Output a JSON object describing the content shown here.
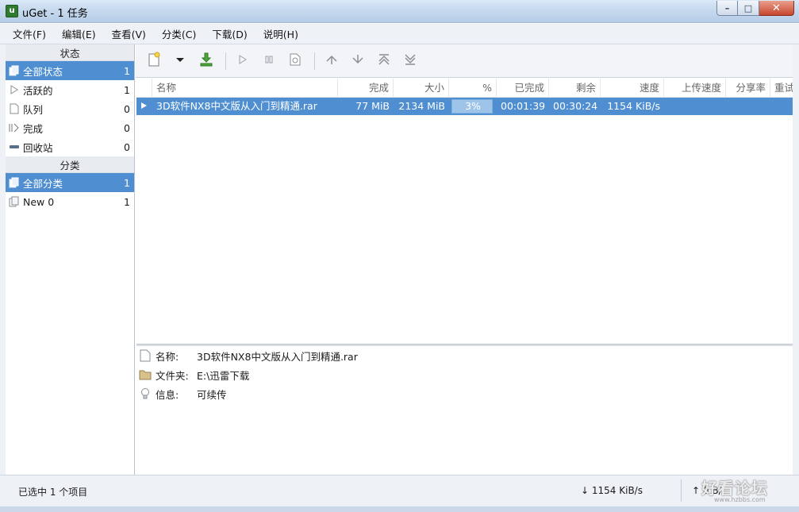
{
  "window": {
    "icon_text": "u",
    "title": "uGet - 1 任务",
    "min": "–",
    "max": "□",
    "close": "✕"
  },
  "menu": [
    "文件(F)",
    "编辑(E)",
    "查看(V)",
    "分类(C)",
    "下载(D)",
    "说明(H)"
  ],
  "sidebar": {
    "status_header": "状态",
    "status_items": [
      {
        "label": "全部状态",
        "count": "1",
        "icon": "all-status-icon",
        "selected": true
      },
      {
        "label": "活跃的",
        "count": "1",
        "icon": "active-icon"
      },
      {
        "label": "队列",
        "count": "0",
        "icon": "queue-icon"
      },
      {
        "label": "完成",
        "count": "0",
        "icon": "finished-icon"
      },
      {
        "label": "回收站",
        "count": "0",
        "icon": "recycle-icon"
      }
    ],
    "category_header": "分类",
    "category_items": [
      {
        "label": "全部分类",
        "count": "1",
        "icon": "all-category-icon",
        "selected": true
      },
      {
        "label": "New 0",
        "count": "1",
        "icon": "category-icon"
      }
    ]
  },
  "toolbar": {
    "buttons": [
      "new-download-icon",
      "dropdown-arrow-icon",
      "batch-download-icon",
      "start-icon",
      "pause-icon",
      "properties-icon",
      "move-up-icon",
      "move-down-icon",
      "move-top-icon",
      "move-bottom-icon"
    ]
  },
  "tasklist": {
    "columns": [
      "名称",
      "完成",
      "大小",
      "%",
      "已完成",
      "剩余",
      "速度",
      "上传速度",
      "分享率",
      "重试"
    ],
    "rows": [
      {
        "name": "3D软件NX8中文版从入门到精通.rar",
        "completed": "77 MiB",
        "size": "2134 MiB",
        "percent": "3%",
        "progress": 0.03,
        "elapsed": "00:01:39",
        "remaining": "00:30:24",
        "speed": "1154 KiB/s",
        "upload_speed": "",
        "ratio": "",
        "retry": ""
      }
    ]
  },
  "details": {
    "name_label": "名称:",
    "name_value": "3D软件NX8中文版从入门到精通.rar",
    "folder_label": "文件夹:",
    "folder_value": "E:\\迅雷下载",
    "info_label": "信息:",
    "info_value": "可续传"
  },
  "statusbar": {
    "selected_text": "已选中 1 个项目",
    "down_arrow": "↓",
    "down_speed": "1154 KiB/s",
    "up_arrow": "↑",
    "up_speed": "0 B/s"
  },
  "watermark": {
    "text": "好看论坛",
    "sub": "www.hzbbs.com"
  },
  "colors": {
    "selection": "#4f8fd1",
    "accent_green": "#3a8a2a"
  }
}
